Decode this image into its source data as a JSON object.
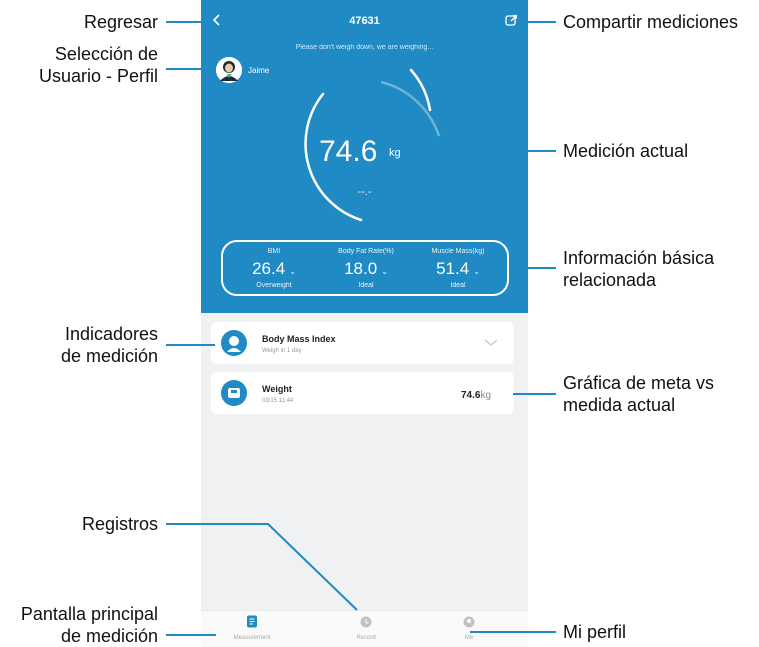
{
  "app": {
    "title": "47631",
    "status_note": "Please don't weigh down, we are weighing...",
    "user_name": "Jaime",
    "weight": {
      "value": "74.6",
      "unit": "kg",
      "secondary": "--.-"
    },
    "metrics": [
      {
        "label": "BMI",
        "value": "26.4",
        "status": "Overweight"
      },
      {
        "label": "Body Fat Rate(%)",
        "value": "18.0",
        "status": "Ideal"
      },
      {
        "label": "Muscle Mass(kg)",
        "value": "51.4",
        "status": "Ideal"
      }
    ],
    "cards": {
      "bmi": {
        "title": "Body Mass Index",
        "subtitle": "Weigh in 1 day"
      },
      "weight": {
        "title": "Weight",
        "subtitle": "03/15 11:44",
        "value": "74.6",
        "unit": "kg"
      }
    },
    "tabs": [
      {
        "label": "Measurement",
        "active": true
      },
      {
        "label": "Record",
        "active": false
      },
      {
        "label": "Me",
        "active": false
      }
    ],
    "colors": {
      "primary": "#1f8ac4",
      "background": "#f0f1f3"
    }
  },
  "callouts": {
    "back": "Regresar",
    "user_select_line1": "Selección de",
    "user_select_line2": "Usuario - Perfil",
    "share": "Compartir mediciones",
    "current_measure": "Medición actual",
    "basic_info_line1": "Información básica",
    "basic_info_line2": "relacionada",
    "indicators_line1": "Indicadores",
    "indicators_line2": "de medición",
    "goal_chart_line1": "Gráfica de meta vs",
    "goal_chart_line2": "medida actual",
    "records": "Registros",
    "main_screen_line1": "Pantalla principal",
    "main_screen_line2": "de medición",
    "my_profile": "Mi perfil"
  }
}
